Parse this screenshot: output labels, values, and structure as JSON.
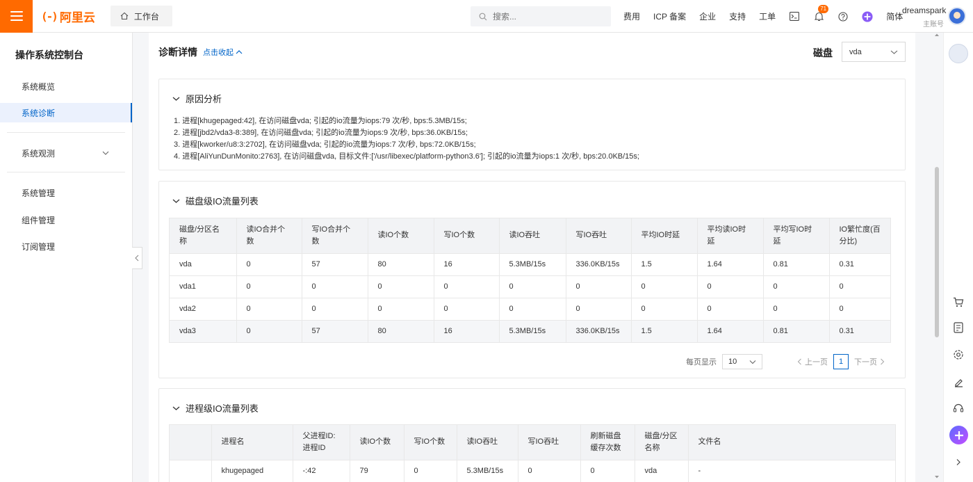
{
  "topbar": {
    "logo_text": "阿里云",
    "logo_mark": "(-)",
    "workbench": "工作台",
    "search_placeholder": "搜索...",
    "nav": [
      "费用",
      "ICP 备案",
      "企业",
      "支持",
      "工单"
    ],
    "notification_count": "71",
    "lang": "简体",
    "user_name": "dreamspark",
    "user_role": "主账号"
  },
  "sidebar": {
    "title": "操作系统控制台",
    "items": [
      "系统概览",
      "系统诊断",
      "系统观测",
      "系统管理",
      "组件管理",
      "订阅管理"
    ]
  },
  "main": {
    "title": "诊断详情",
    "collapse_link": "点击收起",
    "disk_label": "磁盘",
    "disk_value": "vda",
    "reason": {
      "title": "原因分析",
      "lines": [
        "1. 进程[khugepaged:42], 在访问磁盘vda; 引起的io流量为iops:79 次/秒, bps:5.3MB/15s;",
        "2. 进程[jbd2/vda3-8:389], 在访问磁盘vda; 引起的io流量为iops:9 次/秒, bps:36.0KB/15s;",
        "3. 进程[kworker/u8:3:2702], 在访问磁盘vda; 引起的io流量为iops:7 次/秒, bps:72.0KB/15s;",
        "4. 进程[AliYunDunMonito:2763], 在访问磁盘vda, 目标文件:['/usr/libexec/platform-python3.6']; 引起的io流量为iops:1 次/秒, bps:20.0KB/15s;"
      ]
    },
    "disk_table": {
      "title": "磁盘级IO流量列表",
      "headers": [
        "磁盘/分区名称",
        "读IO合并个数",
        "写IO合并个数",
        "读IO个数",
        "写IO个数",
        "读IO吞吐",
        "写IO吞吐",
        "平均IO时延",
        "平均读IO时延",
        "平均写IO时延",
        "IO繁忙度(百分比)"
      ],
      "rows": [
        [
          "vda",
          "0",
          "57",
          "80",
          "16",
          "5.3MB/15s",
          "336.0KB/15s",
          "1.5",
          "1.64",
          "0.81",
          "0.31"
        ],
        [
          "vda1",
          "0",
          "0",
          "0",
          "0",
          "0",
          "0",
          "0",
          "0",
          "0",
          "0"
        ],
        [
          "vda2",
          "0",
          "0",
          "0",
          "0",
          "0",
          "0",
          "0",
          "0",
          "0",
          "0"
        ],
        [
          "vda3",
          "0",
          "57",
          "80",
          "16",
          "5.3MB/15s",
          "336.0KB/15s",
          "1.5",
          "1.64",
          "0.81",
          "0.31"
        ]
      ],
      "pager": {
        "per_page_label": "每页显示",
        "per_page": "10",
        "prev": "上一页",
        "current": "1",
        "next": "下一页"
      }
    },
    "proc_table": {
      "title": "进程级IO流量列表",
      "headers": [
        "",
        "进程名",
        "父进程ID:进程ID",
        "读IO个数",
        "写IO个数",
        "读IO吞吐",
        "写IO吞吐",
        "刷新磁盘缓存次数",
        "磁盘/分区名称",
        "文件名"
      ],
      "rows": [
        [
          "",
          "khugepaged",
          "-:42",
          "79",
          "0",
          "5.3MB/15s",
          "0",
          "0",
          "vda",
          "-"
        ]
      ]
    }
  },
  "colors": {
    "brand": "#ff6a00",
    "link": "#0064c8"
  }
}
